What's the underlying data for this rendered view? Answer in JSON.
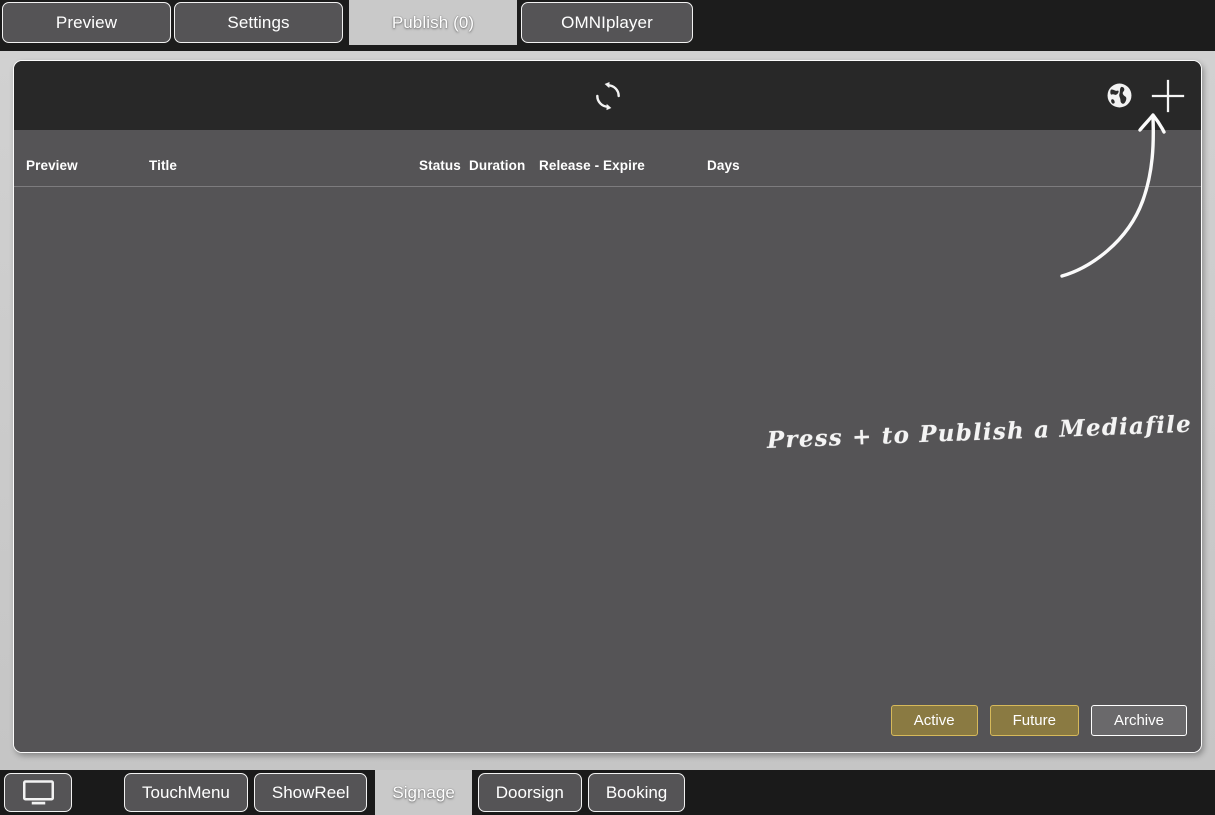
{
  "window": {
    "tabs": [
      {
        "label": "Preview",
        "name": "tab-preview",
        "active": false
      },
      {
        "label": "Settings",
        "name": "tab-settings",
        "active": false
      },
      {
        "label": "Publish (0)",
        "name": "tab-publish",
        "active": true
      },
      {
        "label": "OMNIplayer",
        "name": "tab-omniplayer",
        "active": false
      }
    ]
  },
  "toolbar": {
    "refresh_icon": "refresh-sync-icon",
    "globe_icon": "globe-icon",
    "add_icon": "plus-icon"
  },
  "table": {
    "columns": [
      {
        "label": "Preview",
        "name": "column-header-preview"
      },
      {
        "label": "Title",
        "name": "column-header-title"
      },
      {
        "label": "Status",
        "name": "column-header-status"
      },
      {
        "label": "Duration",
        "name": "column-header-duration"
      },
      {
        "label": "Release - Expire",
        "name": "column-header-release-expire"
      },
      {
        "label": "Days",
        "name": "column-header-days"
      }
    ],
    "rows": [],
    "empty_annotation": "Press + to Publish a Mediafile"
  },
  "filters": [
    {
      "label": "Active",
      "name": "filter-active",
      "selected": true
    },
    {
      "label": "Future",
      "name": "filter-future",
      "selected": true
    },
    {
      "label": "Archive",
      "name": "filter-archive",
      "selected": false
    }
  ],
  "bottom_nav": {
    "home_icon": "monitor-icon",
    "items": [
      {
        "label": "TouchMenu",
        "name": "nav-touchmenu",
        "active": false
      },
      {
        "label": "ShowReel",
        "name": "nav-showreel",
        "active": false
      },
      {
        "label": "Signage",
        "name": "nav-signage",
        "active": true
      },
      {
        "label": "Doorsign",
        "name": "nav-doorsign",
        "active": false
      },
      {
        "label": "Booking",
        "name": "nav-booking",
        "active": false
      }
    ]
  },
  "colors": {
    "accent_gold": "#8a7a42",
    "accent_gold_border": "#d6b95a",
    "panel_bg": "#555456",
    "toolbar_bg": "#282828",
    "chrome_bg": "#1a1a1a",
    "active_tab_bg": "#c9c9c9"
  }
}
